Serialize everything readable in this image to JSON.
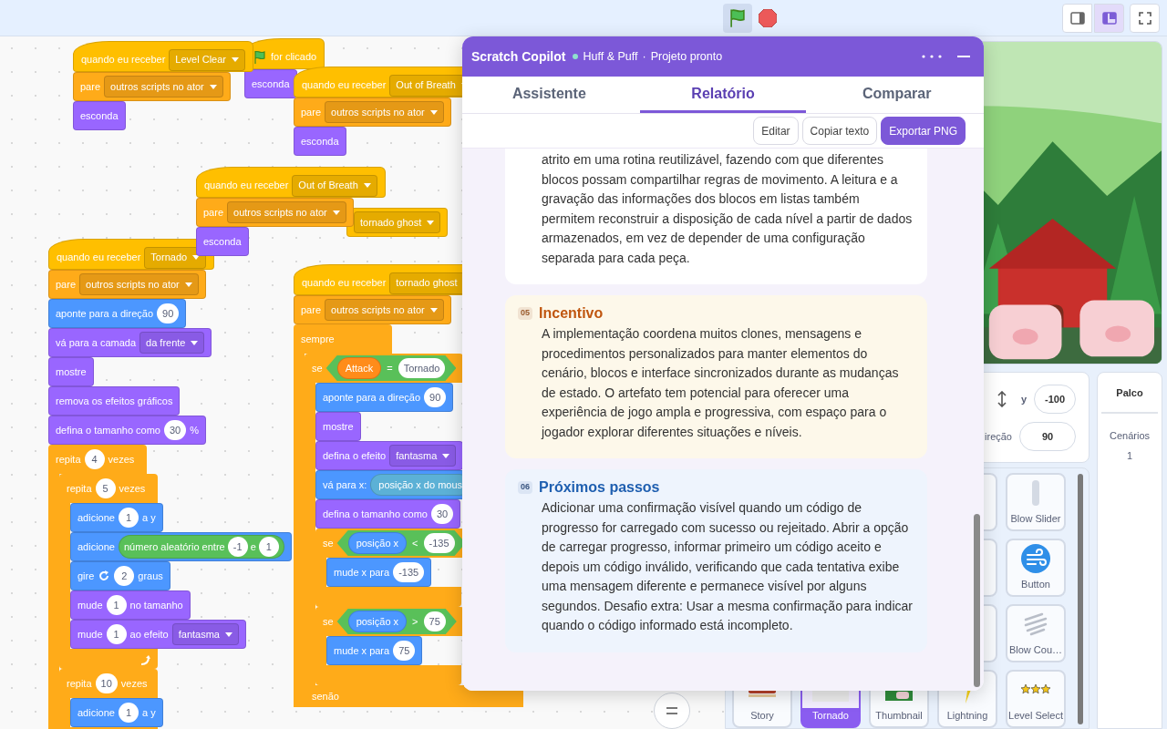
{
  "top_bar": {
    "green_flag": {
      "active": true
    },
    "stage_modes": [
      {
        "selected": false
      },
      {
        "selected": true
      }
    ]
  },
  "scripts": [
    {
      "blocks": [
        {
          "kind": "hat",
          "color": "#ffbf00",
          "parts": [
            {
              "kind": "text",
              "text": "quando eu receber"
            },
            {
              "kind": "dropdown",
              "text": "Level Clear"
            }
          ]
        },
        {
          "kind": "stack",
          "color": "#ffab19",
          "parts": [
            {
              "kind": "text",
              "text": "pare"
            },
            {
              "kind": "dropdown",
              "text": "outros scripts no ator"
            }
          ]
        },
        {
          "kind": "stack",
          "color": "#9966ff",
          "parts": [
            {
              "kind": "text",
              "text": "esconda"
            }
          ]
        }
      ]
    },
    {
      "blocks": [
        {
          "kind": "hat",
          "color": "#ffbf00",
          "parts": [
            {
              "kind": "flag"
            },
            {
              "kind": "text",
              "text": "for clicado"
            }
          ]
        },
        {
          "kind": "stack",
          "color": "#9966ff",
          "parts": [
            {
              "kind": "text",
              "text": "esconda"
            }
          ]
        }
      ]
    },
    {
      "blocks": [
        {
          "kind": "hat",
          "color": "#ffbf00",
          "parts": [
            {
              "kind": "text",
              "text": "quando eu receber"
            },
            {
              "kind": "dropdown",
              "text": "Out of Breath"
            }
          ]
        },
        {
          "kind": "stack",
          "color": "#ffab19",
          "parts": [
            {
              "kind": "text",
              "text": "pare"
            },
            {
              "kind": "dropdown",
              "text": "outros scripts no ator"
            }
          ]
        },
        {
          "kind": "stack",
          "color": "#9966ff",
          "parts": [
            {
              "kind": "text",
              "text": "esconda"
            }
          ]
        }
      ]
    },
    {
      "blocks": [
        {
          "kind": "hat",
          "color": "#ffbf00",
          "parts": [
            {
              "kind": "text",
              "text": "quando eu receber"
            },
            {
              "kind": "dropdown",
              "text": "Out of Breath"
            }
          ]
        },
        {
          "kind": "stack",
          "color": "#ffab19",
          "parts": [
            {
              "kind": "text",
              "text": "pare"
            },
            {
              "kind": "dropdown",
              "text": "outros scripts no ator"
            }
          ]
        },
        {
          "kind": "stack",
          "color": "#9966ff",
          "parts": [
            {
              "kind": "text",
              "text": "esconda"
            }
          ]
        }
      ]
    },
    {
      "blocks": [
        {
          "kind": "stack",
          "color": "#ffbf00",
          "parts": [
            {
              "kind": "dropdown",
              "text": "tornado ghost"
            }
          ]
        }
      ]
    },
    {
      "blocks": [
        {
          "kind": "hat",
          "color": "#ffbf00",
          "parts": [
            {
              "kind": "text",
              "text": "quando eu receber"
            },
            {
              "kind": "dropdown",
              "text": "Tornado"
            }
          ]
        },
        {
          "kind": "stack",
          "color": "#ffab19",
          "parts": [
            {
              "kind": "text",
              "text": "pare"
            },
            {
              "kind": "dropdown",
              "text": "outros scripts no ator"
            }
          ]
        },
        {
          "kind": "stack",
          "color": "#4c97ff",
          "parts": [
            {
              "kind": "text",
              "text": "aponte para a direção"
            },
            {
              "kind": "number",
              "text": "90"
            }
          ]
        },
        {
          "kind": "stack",
          "color": "#9966ff",
          "parts": [
            {
              "kind": "text",
              "text": "vá para a camada"
            },
            {
              "kind": "dropdown",
              "text": "da frente"
            }
          ]
        },
        {
          "kind": "stack",
          "color": "#9966ff",
          "parts": [
            {
              "kind": "text",
              "text": "mostre"
            }
          ]
        },
        {
          "kind": "stack",
          "color": "#9966ff",
          "parts": [
            {
              "kind": "text",
              "text": "remova os efeitos gráficos"
            }
          ]
        },
        {
          "kind": "stack",
          "color": "#9966ff",
          "parts": [
            {
              "kind": "text",
              "text": "defina o tamanho como"
            },
            {
              "kind": "number",
              "text": "30"
            },
            {
              "kind": "text",
              "text": "%"
            }
          ]
        },
        {
          "kind": "loop",
          "color": "#ffab19",
          "continues": true,
          "parts": [
            {
              "kind": "text",
              "text": "repita"
            },
            {
              "kind": "number",
              "text": "4"
            },
            {
              "kind": "text",
              "text": "vezes"
            }
          ],
          "children": [
            {
              "kind": "loop",
              "color": "#ffab19",
              "parts": [
                {
                  "kind": "text",
                  "text": "repita"
                },
                {
                  "kind": "number",
                  "text": "5"
                },
                {
                  "kind": "text",
                  "text": "vezes"
                }
              ],
              "children": [
                {
                  "kind": "stack",
                  "color": "#4c97ff",
                  "parts": [
                    {
                      "kind": "text",
                      "text": "adicione"
                    },
                    {
                      "kind": "number",
                      "text": "1"
                    },
                    {
                      "kind": "text",
                      "text": "a y"
                    }
                  ]
                },
                {
                  "kind": "stack",
                  "color": "#4c97ff",
                  "parts": [
                    {
                      "kind": "text",
                      "text": "adicione"
                    },
                    {
                      "kind": "reporter",
                      "color": "#59c059",
                      "parts": [
                        {
                          "kind": "text",
                          "text": "número aleatório entre"
                        },
                        {
                          "kind": "number",
                          "text": "-1"
                        },
                        {
                          "kind": "text",
                          "text": "e"
                        },
                        {
                          "kind": "number",
                          "text": "1"
                        }
                      ]
                    }
                  ]
                },
                {
                  "kind": "stack",
                  "color": "#4c97ff",
                  "parts": [
                    {
                      "kind": "text",
                      "text": "gire"
                    },
                    {
                      "kind": "turn"
                    },
                    {
                      "kind": "number",
                      "text": "2"
                    },
                    {
                      "kind": "text",
                      "text": "graus"
                    }
                  ]
                },
                {
                  "kind": "stack",
                  "color": "#9966ff",
                  "parts": [
                    {
                      "kind": "text",
                      "text": "mude"
                    },
                    {
                      "kind": "number",
                      "text": "1"
                    },
                    {
                      "kind": "text",
                      "text": "no tamanho"
                    }
                  ]
                },
                {
                  "kind": "stack",
                  "color": "#9966ff",
                  "parts": [
                    {
                      "kind": "text",
                      "text": "mude"
                    },
                    {
                      "kind": "number",
                      "text": "1"
                    },
                    {
                      "kind": "text",
                      "text": "ao efeito"
                    },
                    {
                      "kind": "dropdown",
                      "text": "fantasma"
                    }
                  ]
                }
              ]
            },
            {
              "kind": "loop",
              "color": "#ffab19",
              "parts": [
                {
                  "kind": "text",
                  "text": "repita"
                },
                {
                  "kind": "number",
                  "text": "10"
                },
                {
                  "kind": "text",
                  "text": "vezes"
                }
              ],
              "children": [
                {
                  "kind": "stack",
                  "color": "#4c97ff",
                  "parts": [
                    {
                      "kind": "text",
                      "text": "adicione"
                    },
                    {
                      "kind": "number",
                      "text": "1"
                    },
                    {
                      "kind": "text",
                      "text": "a y"
                    }
                  ]
                }
              ]
            }
          ]
        }
      ]
    },
    {
      "blocks": [
        {
          "kind": "hat",
          "color": "#ffbf00",
          "parts": [
            {
              "kind": "text",
              "text": "quando eu receber"
            },
            {
              "kind": "dropdown",
              "text": "tornado ghost"
            }
          ]
        },
        {
          "kind": "stack",
          "color": "#ffab19",
          "parts": [
            {
              "kind": "text",
              "text": "pare"
            },
            {
              "kind": "dropdown",
              "text": "outros scripts no ator"
            }
          ]
        },
        {
          "kind": "loop",
          "color": "#ffab19",
          "continues": true,
          "parts": [
            {
              "kind": "text",
              "text": "sempre"
            }
          ],
          "children": [
            {
              "kind": "ifelse",
              "color": "#ffab19",
              "continues": true,
              "parts": [
                {
                  "kind": "text",
                  "text": "se"
                },
                {
                  "kind": "boolean",
                  "color": "#59c059",
                  "parts": [
                    {
                      "kind": "reporter",
                      "color": "#ff8c1a",
                      "text": "Attack"
                    },
                    {
                      "kind": "text",
                      "text": "="
                    },
                    {
                      "kind": "number",
                      "text": "Tornado"
                    }
                  ]
                }
              ],
              "else_label": "senão",
              "children": [
                {
                  "kind": "stack",
                  "color": "#4c97ff",
                  "parts": [
                    {
                      "kind": "text",
                      "text": "aponte para a direção"
                    },
                    {
                      "kind": "number",
                      "text": "90"
                    }
                  ]
                },
                {
                  "kind": "stack",
                  "color": "#9966ff",
                  "parts": [
                    {
                      "kind": "text",
                      "text": "mostre"
                    }
                  ]
                },
                {
                  "kind": "stack",
                  "color": "#9966ff",
                  "parts": [
                    {
                      "kind": "text",
                      "text": "defina o efeito"
                    },
                    {
                      "kind": "dropdown",
                      "text": "fantasma"
                    }
                  ]
                },
                {
                  "kind": "stack",
                  "color": "#4c97ff",
                  "parts": [
                    {
                      "kind": "text",
                      "text": "vá para x:"
                    },
                    {
                      "kind": "reporter",
                      "color": "#5cb1d6",
                      "text": "posição x do mous"
                    }
                  ]
                },
                {
                  "kind": "stack",
                  "color": "#9966ff",
                  "parts": [
                    {
                      "kind": "text",
                      "text": "defina o tamanho como"
                    },
                    {
                      "kind": "number",
                      "text": "30"
                    }
                  ]
                },
                {
                  "kind": "if",
                  "color": "#ffab19",
                  "parts": [
                    {
                      "kind": "text",
                      "text": "se"
                    },
                    {
                      "kind": "boolean",
                      "color": "#59c059",
                      "parts": [
                        {
                          "kind": "reporter",
                          "color": "#4c97ff",
                          "text": "posição x"
                        },
                        {
                          "kind": "text",
                          "text": "<"
                        },
                        {
                          "kind": "number",
                          "text": "-135"
                        }
                      ]
                    }
                  ],
                  "children": [
                    {
                      "kind": "stack",
                      "color": "#4c97ff",
                      "parts": [
                        {
                          "kind": "text",
                          "text": "mude x para"
                        },
                        {
                          "kind": "number",
                          "text": "-135"
                        }
                      ]
                    }
                  ]
                },
                {
                  "kind": "if",
                  "color": "#ffab19",
                  "parts": [
                    {
                      "kind": "text",
                      "text": "se"
                    },
                    {
                      "kind": "boolean",
                      "color": "#59c059",
                      "parts": [
                        {
                          "kind": "reporter",
                          "color": "#4c97ff",
                          "text": "posição x"
                        },
                        {
                          "kind": "text",
                          "text": ">"
                        },
                        {
                          "kind": "number",
                          "text": "75"
                        }
                      ]
                    }
                  ],
                  "children": [
                    {
                      "kind": "stack",
                      "color": "#4c97ff",
                      "parts": [
                        {
                          "kind": "text",
                          "text": "mude x para"
                        },
                        {
                          "kind": "number",
                          "text": "75"
                        }
                      ]
                    }
                  ]
                }
              ]
            }
          ]
        }
      ]
    }
  ],
  "copilot": {
    "title": "Scratch Copilot",
    "project": "Huff & Puff",
    "separator": "·",
    "status": "Projeto pronto",
    "tabs": [
      {
        "label": "Assistente",
        "selected": false
      },
      {
        "label": "Relatório",
        "selected": true
      },
      {
        "label": "Comparar",
        "selected": false
      }
    ],
    "actions": [
      {
        "label": "Editar",
        "kind": "secondary"
      },
      {
        "label": "Copiar texto",
        "kind": "secondary"
      },
      {
        "label": "Exportar PNG",
        "kind": "primary"
      }
    ],
    "sections": [
      {
        "kind": "plain",
        "text": "atrito em uma rotina reutilizável, fazendo com que diferentes blocos possam compartilhar regras de movimento. A leitura e a gravação das informações dos blocos em listas também permitem reconstruir a disposição de cada nível a partir de dados armazenados, em vez de depender de uma configuração separada para cada peça."
      },
      {
        "kind": "incentive",
        "number": "05",
        "title": "Incentivo",
        "text": "A implementação coordena muitos clones, mensagens e procedimentos personalizados para manter elementos do cenário, blocos e interface sincronizados durante as mudanças de estado. O artefato tem potencial para oferecer uma experiência de jogo ampla e progressiva, com espaço para o jogador explorar diferentes situações e níveis."
      },
      {
        "kind": "next",
        "number": "06",
        "title": "Próximos passos",
        "text": "Adicionar uma confirmação visível quando um código de progresso for carregado com sucesso ou rejeitado. Abrir a opção de carregar progresso, informar primeiro um código aceito e depois um código inválido, verificando que cada tentativa exibe uma mensagem diferente e permanece visível por alguns segundos. Desafio extra: Usar a mesma confirmação para indicar quando o código informado está incompleto."
      }
    ]
  },
  "sprite_info": {
    "y_label": "y",
    "y_value": "-100",
    "direction_label": "ireção",
    "direction_value": "90"
  },
  "stage_panel": {
    "title": "Palco",
    "backdrops_label": "Cenários",
    "backdrops_count": "1"
  },
  "sprites": [
    {
      "name": "Blow Slider",
      "selected": false
    },
    {
      "name": "Button",
      "selected": false
    },
    {
      "name": "Blow Cou…",
      "selected": false
    },
    {
      "name": "Story",
      "selected": false
    },
    {
      "name": "Tornado",
      "selected": true
    },
    {
      "name": "Thumbnail",
      "selected": false
    },
    {
      "name": "Lightning",
      "selected": false
    },
    {
      "name": "Level Select",
      "selected": false
    }
  ]
}
